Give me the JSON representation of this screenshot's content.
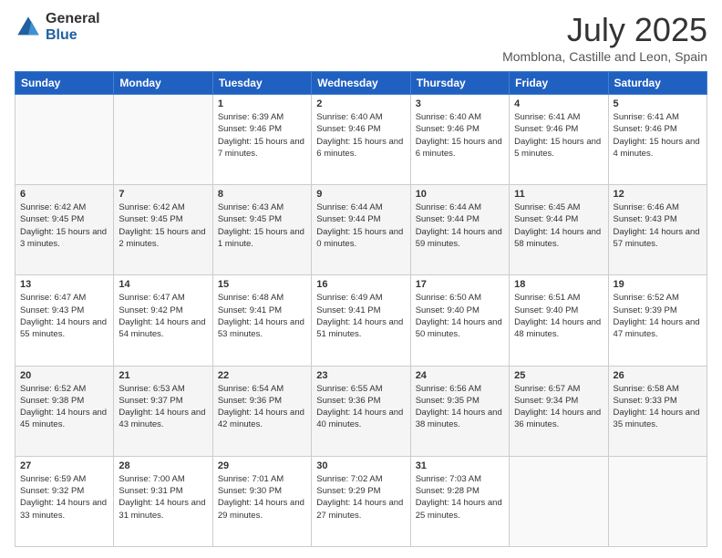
{
  "logo": {
    "general": "General",
    "blue": "Blue"
  },
  "header": {
    "title": "July 2025",
    "subtitle": "Momblona, Castille and Leon, Spain"
  },
  "weekdays": [
    "Sunday",
    "Monday",
    "Tuesday",
    "Wednesday",
    "Thursday",
    "Friday",
    "Saturday"
  ],
  "weeks": [
    {
      "days": [
        {
          "number": "",
          "info": ""
        },
        {
          "number": "",
          "info": ""
        },
        {
          "number": "1",
          "info": "Sunrise: 6:39 AM\nSunset: 9:46 PM\nDaylight: 15 hours and 7 minutes."
        },
        {
          "number": "2",
          "info": "Sunrise: 6:40 AM\nSunset: 9:46 PM\nDaylight: 15 hours and 6 minutes."
        },
        {
          "number": "3",
          "info": "Sunrise: 6:40 AM\nSunset: 9:46 PM\nDaylight: 15 hours and 6 minutes."
        },
        {
          "number": "4",
          "info": "Sunrise: 6:41 AM\nSunset: 9:46 PM\nDaylight: 15 hours and 5 minutes."
        },
        {
          "number": "5",
          "info": "Sunrise: 6:41 AM\nSunset: 9:46 PM\nDaylight: 15 hours and 4 minutes."
        }
      ]
    },
    {
      "days": [
        {
          "number": "6",
          "info": "Sunrise: 6:42 AM\nSunset: 9:45 PM\nDaylight: 15 hours and 3 minutes."
        },
        {
          "number": "7",
          "info": "Sunrise: 6:42 AM\nSunset: 9:45 PM\nDaylight: 15 hours and 2 minutes."
        },
        {
          "number": "8",
          "info": "Sunrise: 6:43 AM\nSunset: 9:45 PM\nDaylight: 15 hours and 1 minute."
        },
        {
          "number": "9",
          "info": "Sunrise: 6:44 AM\nSunset: 9:44 PM\nDaylight: 15 hours and 0 minutes."
        },
        {
          "number": "10",
          "info": "Sunrise: 6:44 AM\nSunset: 9:44 PM\nDaylight: 14 hours and 59 minutes."
        },
        {
          "number": "11",
          "info": "Sunrise: 6:45 AM\nSunset: 9:44 PM\nDaylight: 14 hours and 58 minutes."
        },
        {
          "number": "12",
          "info": "Sunrise: 6:46 AM\nSunset: 9:43 PM\nDaylight: 14 hours and 57 minutes."
        }
      ]
    },
    {
      "days": [
        {
          "number": "13",
          "info": "Sunrise: 6:47 AM\nSunset: 9:43 PM\nDaylight: 14 hours and 55 minutes."
        },
        {
          "number": "14",
          "info": "Sunrise: 6:47 AM\nSunset: 9:42 PM\nDaylight: 14 hours and 54 minutes."
        },
        {
          "number": "15",
          "info": "Sunrise: 6:48 AM\nSunset: 9:41 PM\nDaylight: 14 hours and 53 minutes."
        },
        {
          "number": "16",
          "info": "Sunrise: 6:49 AM\nSunset: 9:41 PM\nDaylight: 14 hours and 51 minutes."
        },
        {
          "number": "17",
          "info": "Sunrise: 6:50 AM\nSunset: 9:40 PM\nDaylight: 14 hours and 50 minutes."
        },
        {
          "number": "18",
          "info": "Sunrise: 6:51 AM\nSunset: 9:40 PM\nDaylight: 14 hours and 48 minutes."
        },
        {
          "number": "19",
          "info": "Sunrise: 6:52 AM\nSunset: 9:39 PM\nDaylight: 14 hours and 47 minutes."
        }
      ]
    },
    {
      "days": [
        {
          "number": "20",
          "info": "Sunrise: 6:52 AM\nSunset: 9:38 PM\nDaylight: 14 hours and 45 minutes."
        },
        {
          "number": "21",
          "info": "Sunrise: 6:53 AM\nSunset: 9:37 PM\nDaylight: 14 hours and 43 minutes."
        },
        {
          "number": "22",
          "info": "Sunrise: 6:54 AM\nSunset: 9:36 PM\nDaylight: 14 hours and 42 minutes."
        },
        {
          "number": "23",
          "info": "Sunrise: 6:55 AM\nSunset: 9:36 PM\nDaylight: 14 hours and 40 minutes."
        },
        {
          "number": "24",
          "info": "Sunrise: 6:56 AM\nSunset: 9:35 PM\nDaylight: 14 hours and 38 minutes."
        },
        {
          "number": "25",
          "info": "Sunrise: 6:57 AM\nSunset: 9:34 PM\nDaylight: 14 hours and 36 minutes."
        },
        {
          "number": "26",
          "info": "Sunrise: 6:58 AM\nSunset: 9:33 PM\nDaylight: 14 hours and 35 minutes."
        }
      ]
    },
    {
      "days": [
        {
          "number": "27",
          "info": "Sunrise: 6:59 AM\nSunset: 9:32 PM\nDaylight: 14 hours and 33 minutes."
        },
        {
          "number": "28",
          "info": "Sunrise: 7:00 AM\nSunset: 9:31 PM\nDaylight: 14 hours and 31 minutes."
        },
        {
          "number": "29",
          "info": "Sunrise: 7:01 AM\nSunset: 9:30 PM\nDaylight: 14 hours and 29 minutes."
        },
        {
          "number": "30",
          "info": "Sunrise: 7:02 AM\nSunset: 9:29 PM\nDaylight: 14 hours and 27 minutes."
        },
        {
          "number": "31",
          "info": "Sunrise: 7:03 AM\nSunset: 9:28 PM\nDaylight: 14 hours and 25 minutes."
        },
        {
          "number": "",
          "info": ""
        },
        {
          "number": "",
          "info": ""
        }
      ]
    }
  ]
}
